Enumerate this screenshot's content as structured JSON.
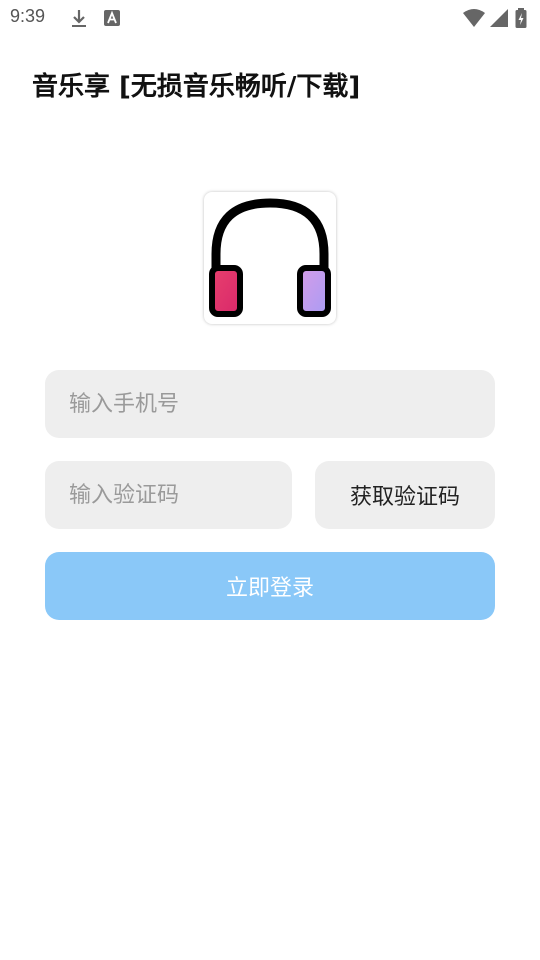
{
  "status_bar": {
    "time": "9:39",
    "icons": [
      "download-icon",
      "text-a-icon",
      "wifi-icon",
      "signal-icon",
      "battery-icon"
    ]
  },
  "app": {
    "title": "音乐享 [无损音乐畅听/下载]",
    "logo_icon": "headphones-icon"
  },
  "form": {
    "phone_placeholder": "输入手机号",
    "code_placeholder": "输入验证码",
    "get_code_label": "获取验证码",
    "login_label": "立即登录"
  },
  "colors": {
    "login_button": "#8ac8f8",
    "field_bg": "#eeeeee",
    "headphone_left": "#e0336f",
    "headphone_right": "#b99af2"
  }
}
